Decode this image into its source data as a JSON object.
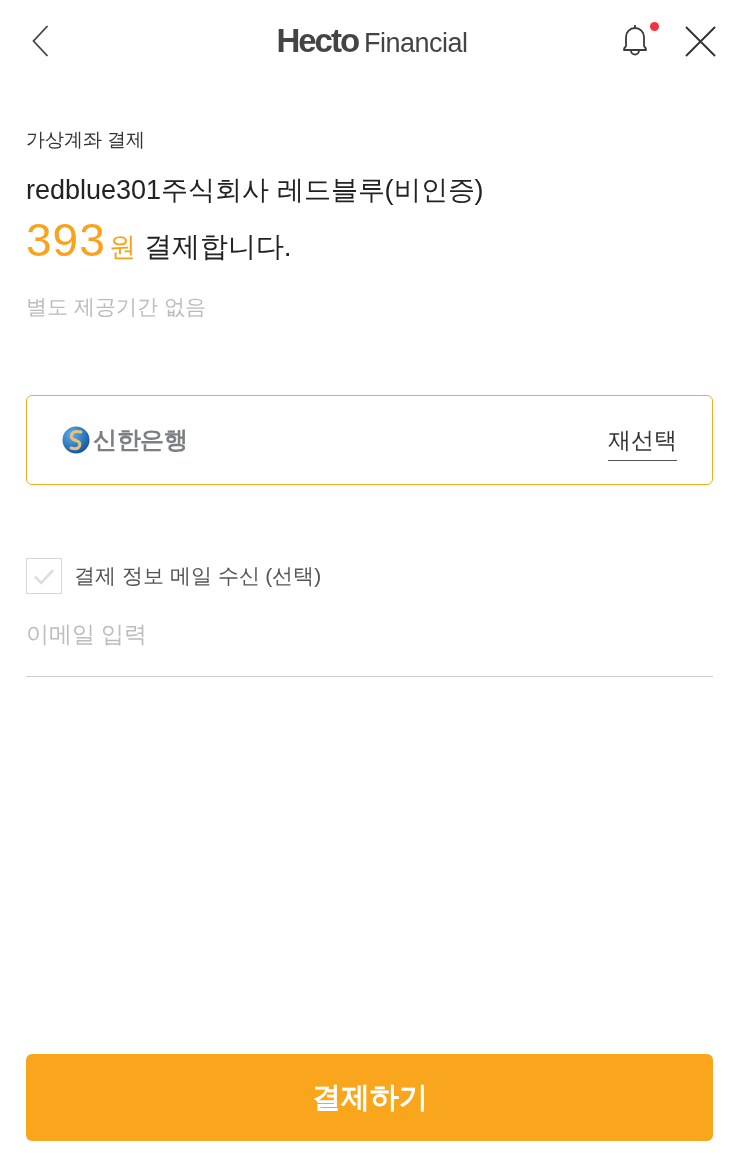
{
  "header": {
    "logo": {
      "brand": "Hecto",
      "suffix": "Financial"
    },
    "notification": {
      "unread": true
    }
  },
  "payment": {
    "method": "가상계좌 결제",
    "merchant": "redblue301주식회사 레드블루(비인증)",
    "amount": "393",
    "currency": "원",
    "action_text": "결제합니다.",
    "period_note": "별도 제공기간 없음"
  },
  "bank": {
    "name": "신한은행",
    "reselect": "재선택"
  },
  "email_opt_in": {
    "label": "결제 정보 메일 수신 (선택)",
    "checked": false
  },
  "email_field": {
    "placeholder": "이메일 입력"
  },
  "submit_button": "결제하기"
}
